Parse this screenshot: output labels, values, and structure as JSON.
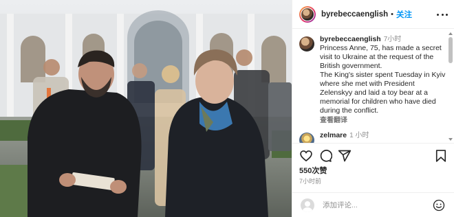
{
  "photo": {
    "description_icon": "photo-icon"
  },
  "header": {
    "username": "byrebeccaenglish",
    "separator": "•",
    "follow_label": "关注",
    "more_icon": "more-options-icon"
  },
  "comments": [
    {
      "username": "byrebeccaenglish",
      "time": "7小时",
      "text": "Princess Anne, 75, has made a secret visit to Ukraine at the request of the British government.\nThe King's sister spent Tuesday in Kyiv where she met with President Zelenskyy and laid a toy bear at a memorial for children who have died during the conflict.",
      "translate_label": "查看翻译"
    },
    {
      "username": "zelmare",
      "time": "1 小时",
      "text": ""
    }
  ],
  "actions": {
    "like_icon": "heart-icon",
    "comment_icon": "comment-icon",
    "share_icon": "send-icon",
    "save_icon": "bookmark-icon"
  },
  "likes": "550次赞",
  "post_time": "7小时前",
  "add_comment": {
    "placeholder": "添加评论...",
    "emoji_icon": "emoji-icon"
  },
  "colors": {
    "accent": "#0095f6",
    "text": "#262626",
    "muted": "#8e8e8e",
    "border": "#efefef"
  }
}
